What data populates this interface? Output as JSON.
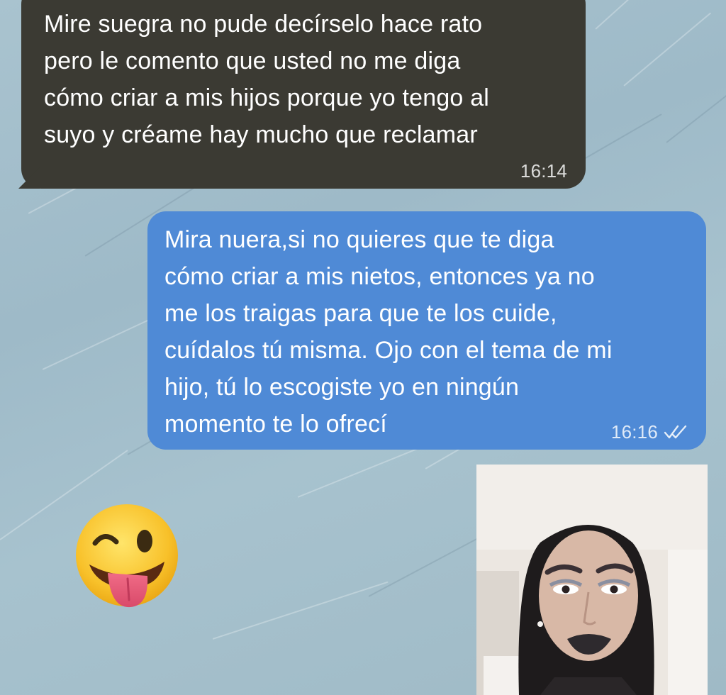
{
  "chat": {
    "incoming_message": {
      "text": "Mire suegra no pude decírselo hace rato\npero le comento que usted no me diga\ncómo criar a mis hijos porque yo tengo al\nsuyo y créame hay mucho que reclamar",
      "time": "16:14"
    },
    "outgoing_message": {
      "text": "Mira nuera,si no quieres que te diga\ncómo criar a mis nietos, entonces ya no\nme los traigas para que te los cuide,\ncuídalos tú misma. Ojo con el tema de mi\nhijo, tú lo escogiste yo en ningún\nmomento te lo ofrecí",
      "time": "16:16",
      "status_icon": "double-check-icon"
    },
    "emoji_message": {
      "icon": "winking-face-with-tongue-emoji"
    },
    "image_message": {
      "icon": "photo-thumbnail"
    }
  },
  "colors": {
    "incoming_bubble": "#3b3a33",
    "outgoing_bubble": "#4f8ad6",
    "wallpaper": "#a9c3cf"
  }
}
